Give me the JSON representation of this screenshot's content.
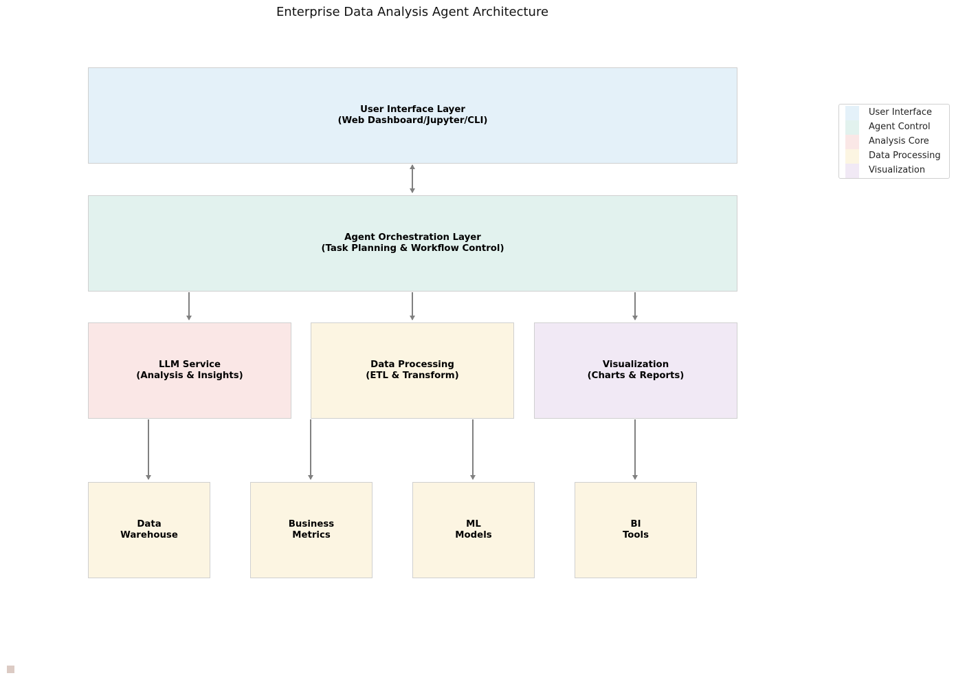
{
  "title": "Enterprise Data Analysis Agent Architecture",
  "colors": {
    "user_interface": "#e4f1f9",
    "agent_control": "#e2f2ee",
    "analysis_core": "#fae7e6",
    "data_processing": "#fcf5e2",
    "visualization": "#f1e9f5",
    "border": "#cfcfcf",
    "arrow": "#808080"
  },
  "nodes": {
    "ui_layer": {
      "label": "User Interface Layer\n(Web Dashboard/Jupyter/CLI)",
      "category": "user_interface"
    },
    "orchestration_layer": {
      "label": "Agent Orchestration Layer\n(Task Planning & Workflow Control)",
      "category": "agent_control"
    },
    "llm_service": {
      "label": "LLM Service\n(Analysis & Insights)",
      "category": "analysis_core"
    },
    "data_processing": {
      "label": "Data Processing\n(ETL & Transform)",
      "category": "data_processing"
    },
    "visualization": {
      "label": "Visualization\n(Charts & Reports)",
      "category": "visualization"
    },
    "data_warehouse": {
      "label": "Data\nWarehouse",
      "category": "data_processing"
    },
    "business_metrics": {
      "label": "Business\nMetrics",
      "category": "data_processing"
    },
    "ml_models": {
      "label": "ML\nModels",
      "category": "data_processing"
    },
    "bi_tools": {
      "label": "BI\nTools",
      "category": "data_processing"
    }
  },
  "edges": [
    {
      "from": "ui_layer",
      "to": "orchestration_layer",
      "direction": "bidirectional"
    },
    {
      "from": "orchestration_layer",
      "to": "llm_service",
      "direction": "forward"
    },
    {
      "from": "orchestration_layer",
      "to": "data_processing",
      "direction": "forward"
    },
    {
      "from": "orchestration_layer",
      "to": "visualization",
      "direction": "forward"
    },
    {
      "from": "llm_service",
      "to": "data_warehouse",
      "direction": "forward"
    },
    {
      "from": "data_processing",
      "to": "business_metrics",
      "direction": "forward"
    },
    {
      "from": "data_processing",
      "to": "ml_models",
      "direction": "forward"
    },
    {
      "from": "visualization",
      "to": "bi_tools",
      "direction": "forward"
    }
  ],
  "legend": {
    "items": [
      {
        "label": "User Interface",
        "category": "user_interface"
      },
      {
        "label": "Agent Control",
        "category": "agent_control"
      },
      {
        "label": "Analysis Core",
        "category": "analysis_core"
      },
      {
        "label": "Data Processing",
        "category": "data_processing"
      },
      {
        "label": "Visualization",
        "category": "visualization"
      }
    ]
  }
}
